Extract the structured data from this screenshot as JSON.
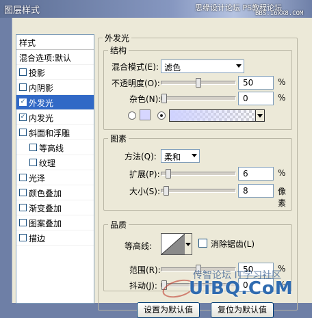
{
  "window": {
    "title": "图层样式"
  },
  "watermark": {
    "top_line": "思缘设计论坛",
    "top_line2": "PS教程论坛",
    "top_url": "BBS.16XX8.COM",
    "bottom_cn": "传智论坛 IT学习社区",
    "bottom_url": "UiBQ.CoM"
  },
  "sidebar": {
    "items": [
      {
        "label": "样式",
        "checkbox": false,
        "checked": false,
        "indent": 0
      },
      {
        "label": "混合选项:默认",
        "checkbox": false,
        "checked": false,
        "indent": 0
      },
      {
        "label": "投影",
        "checkbox": true,
        "checked": false,
        "indent": 0
      },
      {
        "label": "内阴影",
        "checkbox": true,
        "checked": false,
        "indent": 0
      },
      {
        "label": "外发光",
        "checkbox": true,
        "checked": true,
        "indent": 0
      },
      {
        "label": "内发光",
        "checkbox": true,
        "checked": true,
        "indent": 0
      },
      {
        "label": "斜面和浮雕",
        "checkbox": true,
        "checked": false,
        "indent": 0
      },
      {
        "label": "等高线",
        "checkbox": true,
        "checked": false,
        "indent": 1
      },
      {
        "label": "纹理",
        "checkbox": true,
        "checked": false,
        "indent": 1
      },
      {
        "label": "光泽",
        "checkbox": true,
        "checked": false,
        "indent": 0
      },
      {
        "label": "颜色叠加",
        "checkbox": true,
        "checked": false,
        "indent": 0
      },
      {
        "label": "渐变叠加",
        "checkbox": true,
        "checked": false,
        "indent": 0
      },
      {
        "label": "图案叠加",
        "checkbox": true,
        "checked": false,
        "indent": 0
      },
      {
        "label": "描边",
        "checkbox": true,
        "checked": false,
        "indent": 0
      }
    ],
    "selected_index": 4
  },
  "panel": {
    "title": "外发光",
    "structure": {
      "legend": "结构",
      "blend_mode_label": "混合模式(E):",
      "blend_mode_value": "滤色",
      "opacity_label": "不透明度(O):",
      "opacity_value": "50",
      "opacity_unit": "%",
      "opacity_level": 0.5,
      "noise_label": "杂色(N):",
      "noise_value": "0",
      "noise_unit": "%",
      "noise_level": 0.0,
      "color_swatch": "#d6d6ff",
      "gradient_color": "#cfd2ff",
      "color_mode": "gradient"
    },
    "elements": {
      "legend": "图素",
      "technique_label": "方法(Q):",
      "technique_value": "柔和",
      "spread_label": "扩展(P):",
      "spread_value": "6",
      "spread_unit": "%",
      "spread_level": 0.06,
      "size_label": "大小(S):",
      "size_value": "8",
      "size_unit": "像素",
      "size_level": 0.03
    },
    "quality": {
      "legend": "品质",
      "contour_label": "等高线:",
      "antialias_label": "消除锯齿(L)",
      "antialias_checked": false,
      "range_label": "范围(R):",
      "range_value": "50",
      "range_unit": "%",
      "range_level": 0.5,
      "jitter_label": "抖动(J):",
      "jitter_value": "0",
      "jitter_unit": "%",
      "jitter_level": 0.0
    },
    "buttons": {
      "make_default": "设置为默认值",
      "reset_default": "复位为默认值"
    }
  },
  "colors": {
    "selection": "#3169c6",
    "dialog_bg": "#ece9d8",
    "title_bar": "#5d6f95"
  }
}
